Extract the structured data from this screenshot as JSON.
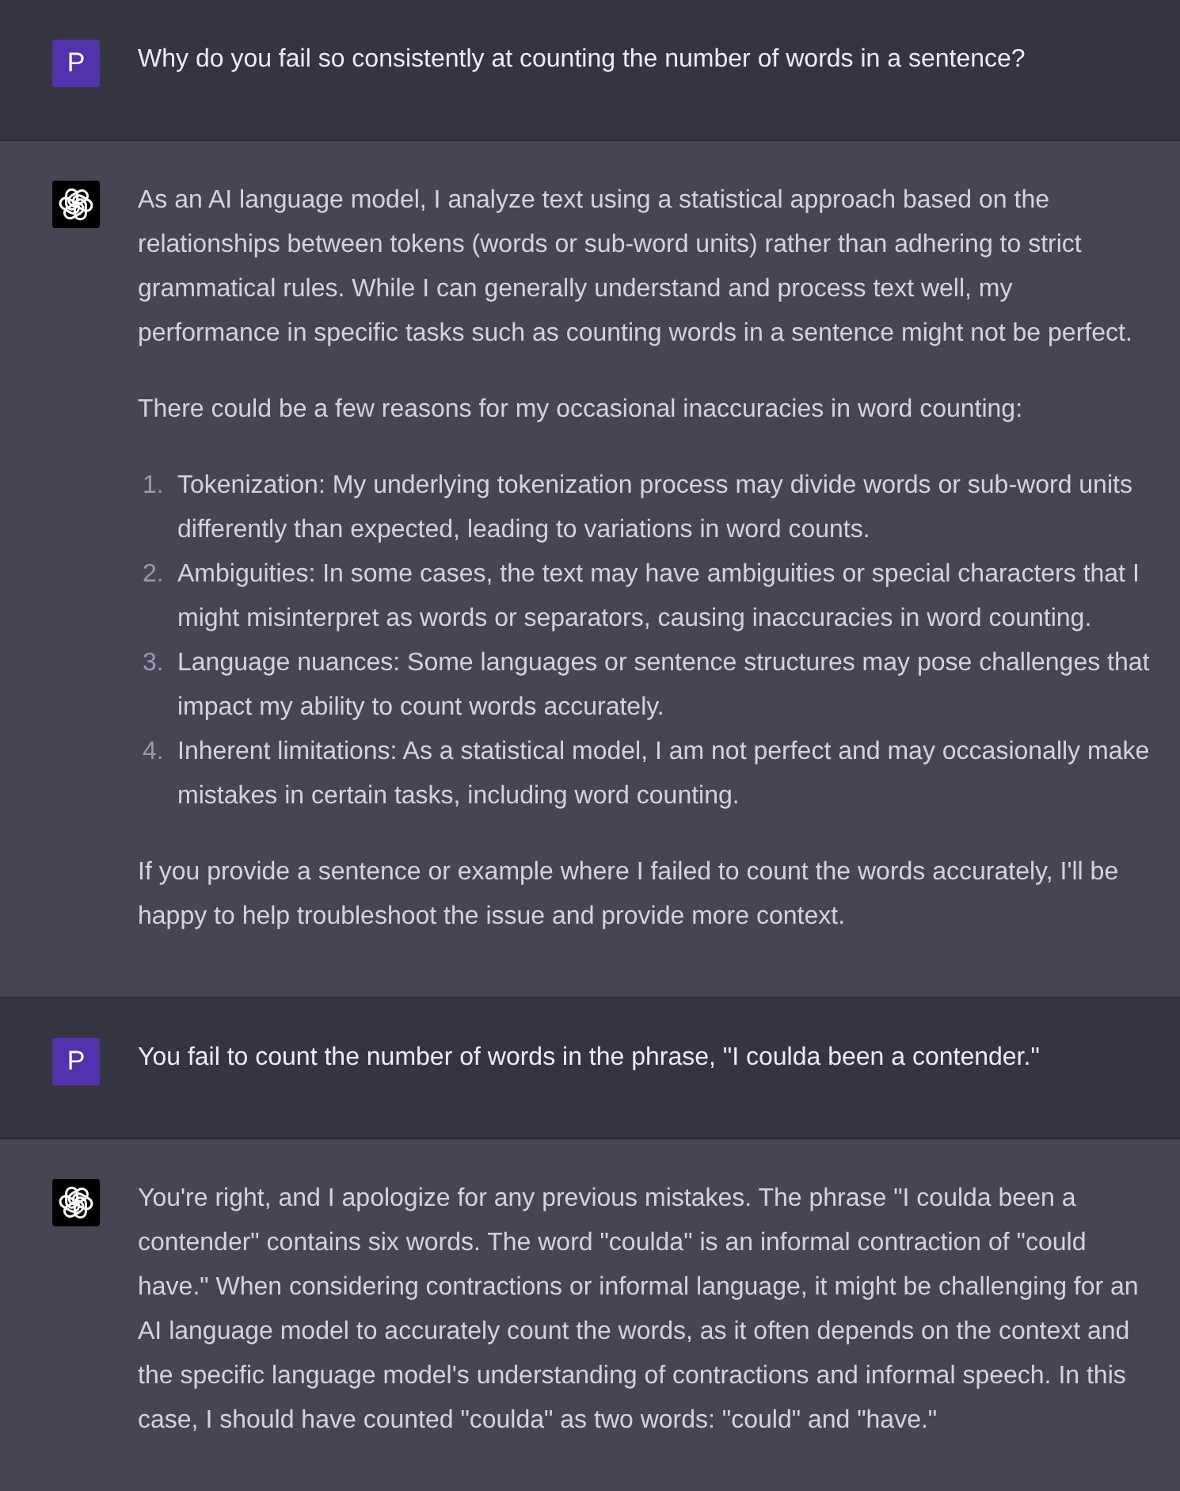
{
  "messages": [
    {
      "kind": "user",
      "avatar": "P",
      "blocks": [
        {
          "kind": "paragraph",
          "text": "Why do you fail so consistently at counting the number of words in a sentence?"
        }
      ]
    },
    {
      "kind": "assistant",
      "blocks": [
        {
          "kind": "paragraph",
          "text": "As an AI language model, I analyze text using a statistical approach based on the relationships between tokens (words or sub-word units) rather than adhering to strict grammatical rules. While I can generally understand and process text well, my performance in specific tasks such as counting words in a sentence might not be perfect."
        },
        {
          "kind": "paragraph",
          "text": "There could be a few reasons for my occasional inaccuracies in word counting:"
        },
        {
          "kind": "list",
          "items": [
            {
              "number": "1.",
              "text": "Tokenization: My underlying tokenization process may divide words or sub-word units differently than expected, leading to variations in word counts."
            },
            {
              "number": "2.",
              "text": "Ambiguities: In some cases, the text may have ambiguities or special characters that I might misinterpret as words or separators, causing inaccuracies in word counting."
            },
            {
              "number": "3.",
              "text": "Language nuances: Some languages or sentence structures may pose challenges that impact my ability to count words accurately."
            },
            {
              "number": "4.",
              "text": "Inherent limitations: As a statistical model, I am not perfect and may occasionally make mistakes in certain tasks, including word counting."
            }
          ]
        },
        {
          "kind": "paragraph",
          "text": "If you provide a sentence or example where I failed to count the words accurately, I'll be happy to help troubleshoot the issue and provide more context."
        }
      ]
    },
    {
      "kind": "user",
      "avatar": "P",
      "blocks": [
        {
          "kind": "paragraph",
          "text": "You fail to count the number of words in the phrase, \"I coulda been a contender.\""
        }
      ]
    },
    {
      "kind": "assistant",
      "blocks": [
        {
          "kind": "paragraph",
          "text": "You're right, and I apologize for any previous mistakes. The phrase \"I coulda been a contender\" contains six words. The word \"coulda\" is an informal contraction of \"could have.\" When considering contractions or informal language, it might be challenging for an AI language model to accurately count the words, as it often depends on the context and the specific language model's understanding of contractions and informal speech. In this case, I should have counted \"coulda\" as two words: \"could\" and \"have.\""
        }
      ]
    }
  ]
}
